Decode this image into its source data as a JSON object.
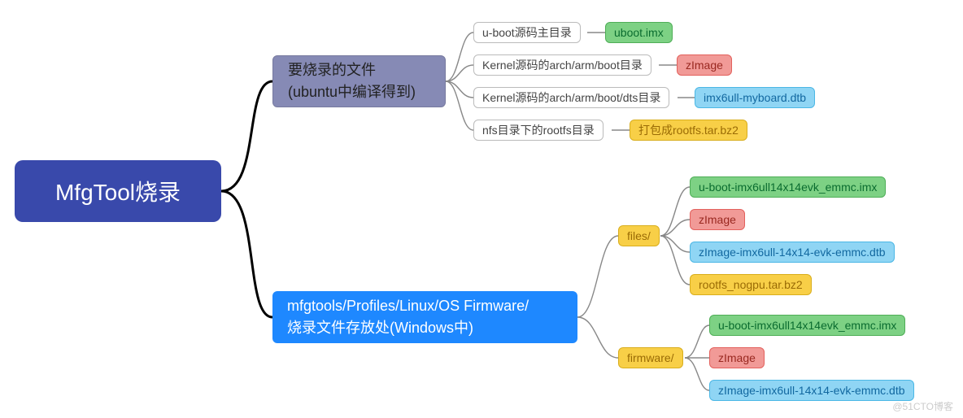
{
  "root": {
    "title": "MfgTool烧录"
  },
  "branch1": {
    "title_line1": "要烧录的文件",
    "title_line2": "(ubuntu中编译得到)",
    "items": [
      {
        "path": "u-boot源码主目录",
        "out": "uboot.imx",
        "out_cls": "green"
      },
      {
        "path": "Kernel源码的arch/arm/boot目录",
        "out": "zImage",
        "out_cls": "red"
      },
      {
        "path": "Kernel源码的arch/arm/boot/dts目录",
        "out": "imx6ull-myboard.dtb",
        "out_cls": "sky"
      },
      {
        "path": "nfs目录下的rootfs目录",
        "out": "打包成rootfs.tar.bz2",
        "out_cls": "yellow"
      }
    ]
  },
  "branch2": {
    "title_line1": "mfgtools/Profiles/Linux/OS Firmware/",
    "title_line2": "烧录文件存放处(Windows中)",
    "dirs": [
      {
        "name": "files/",
        "files": [
          {
            "text": "u-boot-imx6ull14x14evk_emmc.imx",
            "cls": "green"
          },
          {
            "text": "zImage",
            "cls": "red"
          },
          {
            "text": "zImage-imx6ull-14x14-evk-emmc.dtb",
            "cls": "sky"
          },
          {
            "text": "rootfs_nogpu.tar.bz2",
            "cls": "yellow"
          }
        ]
      },
      {
        "name": "firmware/",
        "files": [
          {
            "text": "u-boot-imx6ull14x14evk_emmc.imx",
            "cls": "green"
          },
          {
            "text": "zImage",
            "cls": "red"
          },
          {
            "text": "zImage-imx6ull-14x14-evk-emmc.dtb",
            "cls": "sky"
          }
        ]
      }
    ]
  },
  "watermark": "@51CTO博客"
}
